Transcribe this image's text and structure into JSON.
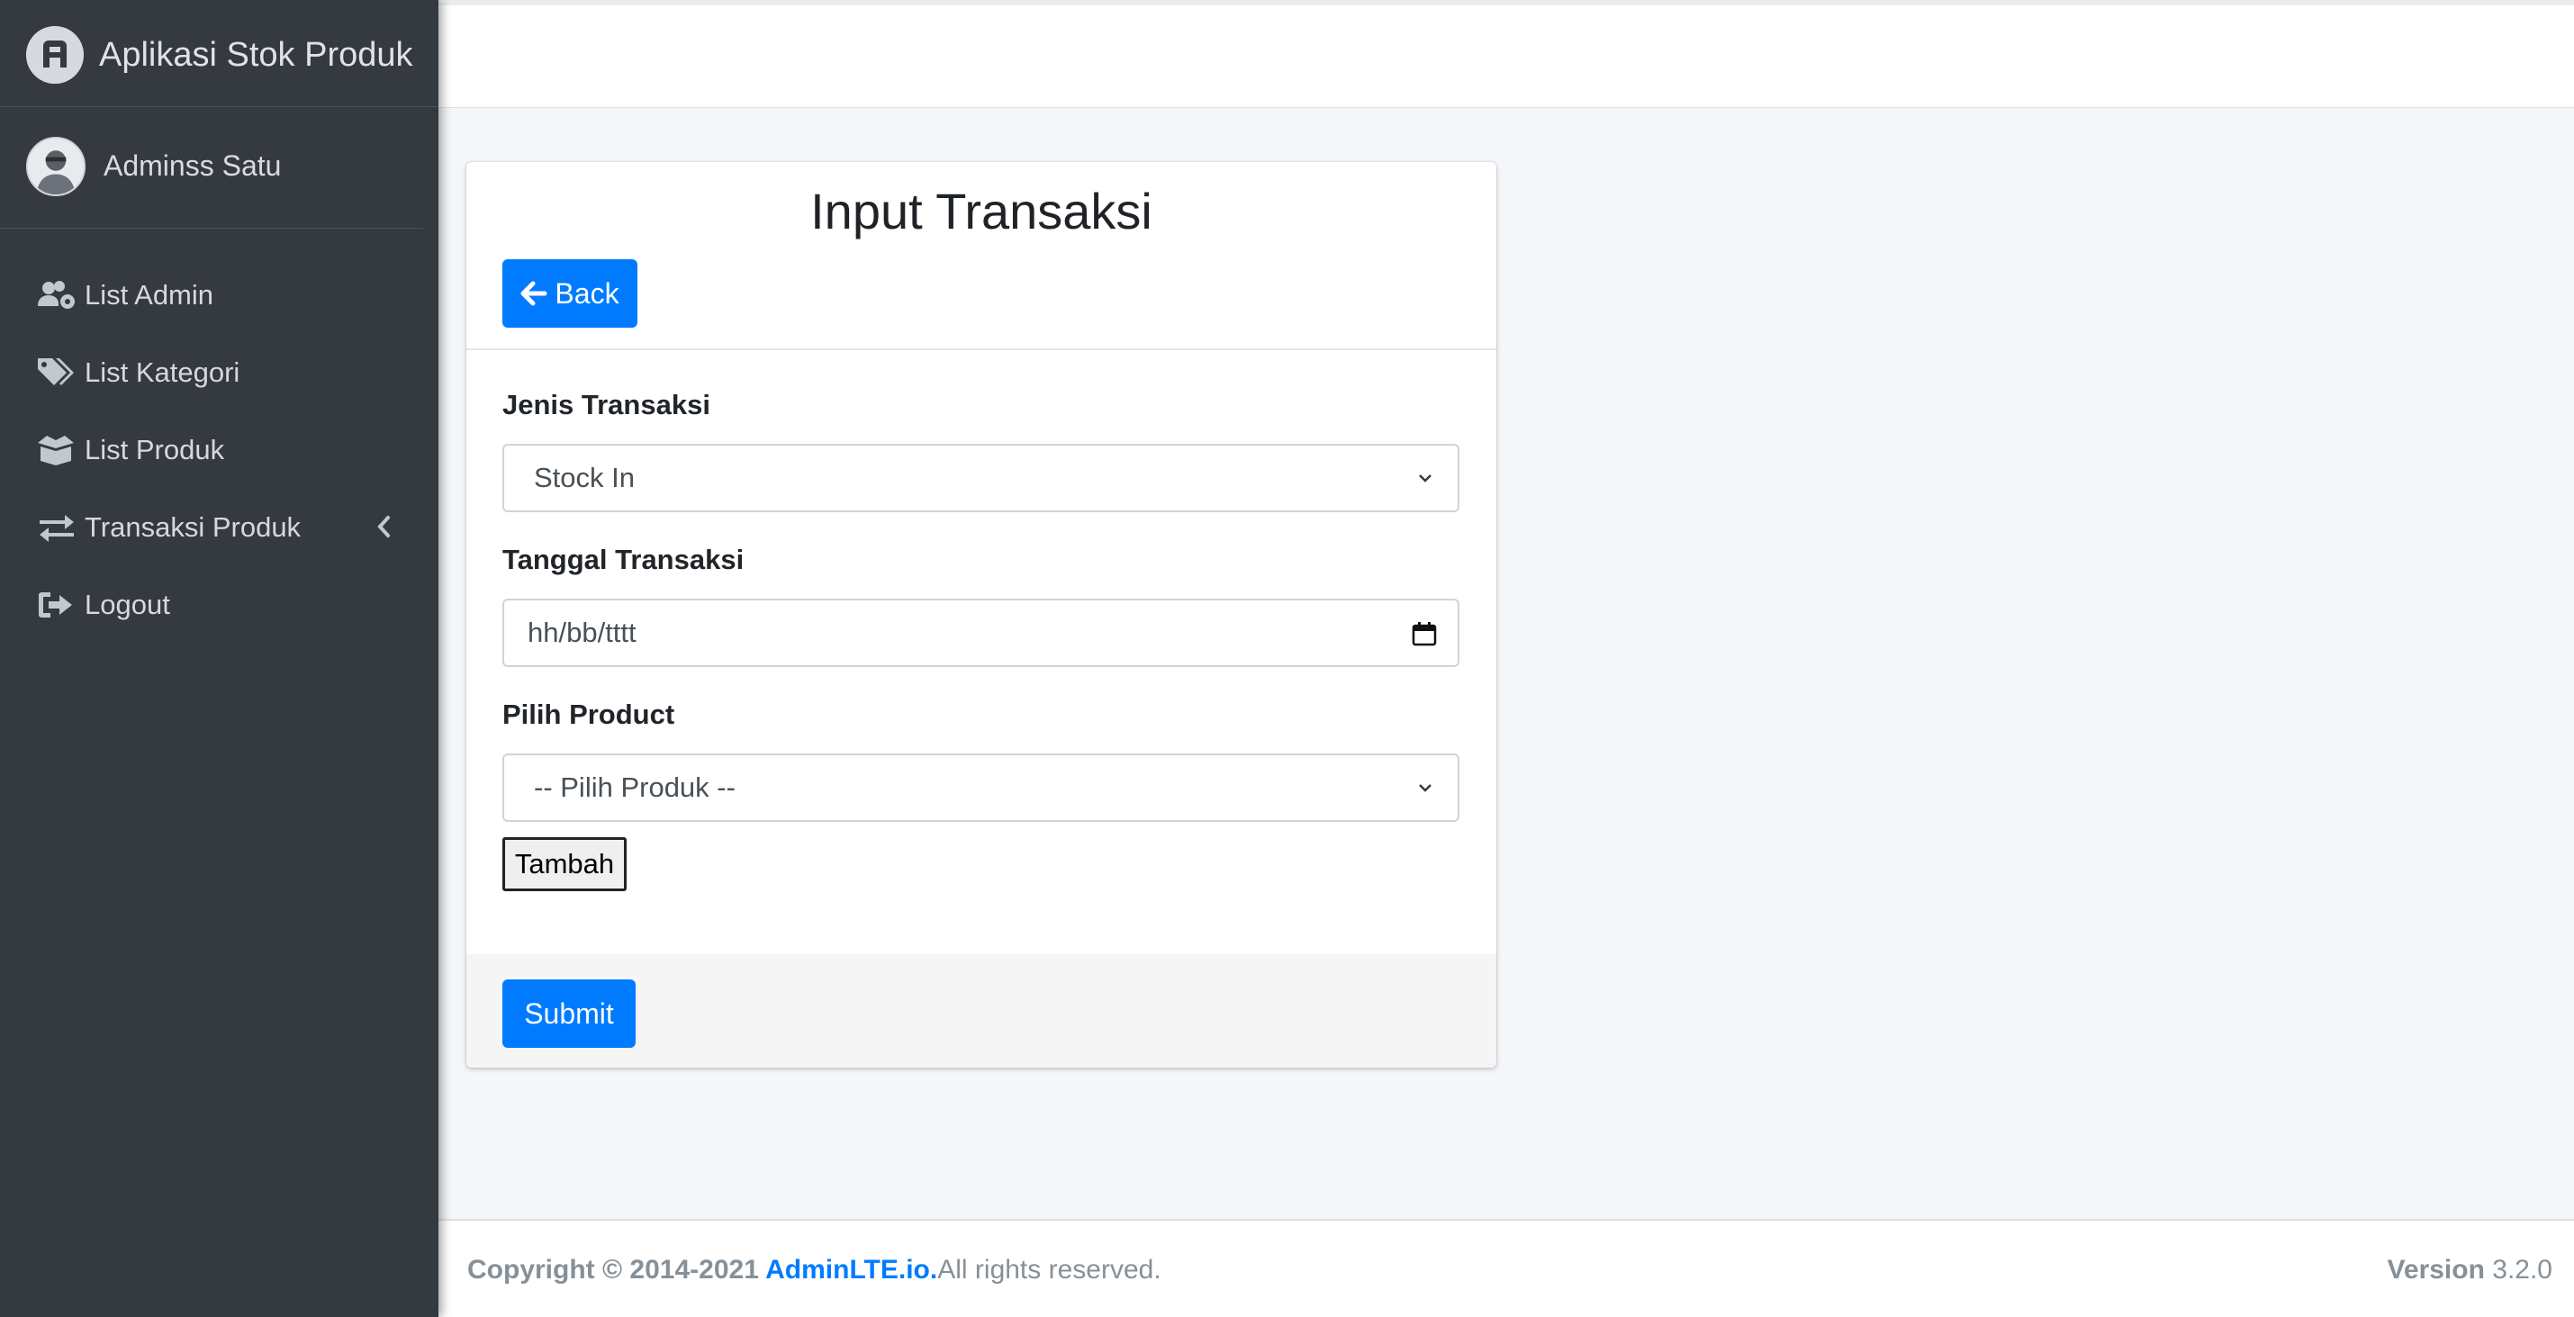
{
  "brand": {
    "title": "Aplikasi Stok Produk"
  },
  "user": {
    "name": "Adminss Satu"
  },
  "sidebar": {
    "items": [
      {
        "label": "List Admin",
        "icon": "users-cog-icon"
      },
      {
        "label": "List Kategori",
        "icon": "tags-icon"
      },
      {
        "label": "List Produk",
        "icon": "box-open-icon"
      },
      {
        "label": "Transaksi Produk",
        "icon": "exchange-icon",
        "has_submenu": true
      },
      {
        "label": "Logout",
        "icon": "sign-out-icon"
      }
    ]
  },
  "card": {
    "title": "Input Transaksi",
    "back_label": "Back",
    "fields": {
      "jenis": {
        "label": "Jenis Transaksi",
        "value": "Stock In"
      },
      "tanggal": {
        "label": "Tanggal Transaksi",
        "placeholder": "hh/bb/tttt"
      },
      "produk": {
        "label": "Pilih Product",
        "value": "-- Pilih Produk --"
      }
    },
    "tambah_label": "Tambah",
    "submit_label": "Submit"
  },
  "footer": {
    "copyright_prefix": "Copyright © 2014-2021 ",
    "link_text": "AdminLTE.io",
    "copyright_suffix": "All rights reserved.",
    "version_label": "Version",
    "version_value": "3.2.0"
  },
  "colors": {
    "sidebar_bg": "#343a40",
    "primary": "#007bff",
    "page_bg": "#f4f6f9"
  }
}
